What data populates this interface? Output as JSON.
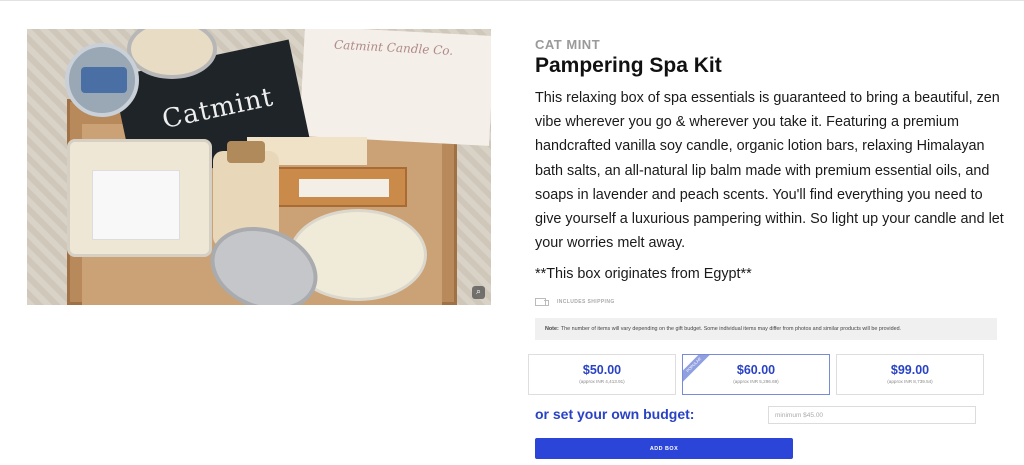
{
  "product": {
    "brand": "CAT MINT",
    "title": "Pampering Spa Kit",
    "description": "This relaxing box of spa essentials is guaranteed to bring a beautiful, zen vibe wherever you go & wherever you take it. Featuring a premium handcrafted vanilla soy candle, organic lotion bars, relaxing Himalayan bath salts, an all-natural lip balm made with premium essential oils, and soaps in lavender and peach scents. You'll find everything you need to give yourself a luxurious pampering within. So light up your candle and let your worries melt away.",
    "origin": "**This box originates from Egypt**",
    "shipping_label": "INCLUDES SHIPPING",
    "note_label": "Note:",
    "note_text": "The number of items will vary depending on the gift budget. Some individual items may differ from photos and similar products will be provided.",
    "photo_brand_text": "Catmint",
    "photo_card_text": "Catmint Candle Co.",
    "zoom_icon": "magnify-icon"
  },
  "budget": {
    "options": [
      {
        "price": "$50.00",
        "approx": "(approx INR 4,413.91)",
        "selected": false
      },
      {
        "price": "$60.00",
        "approx": "(approx INR 5,296.69)",
        "selected": true,
        "ribbon": "POPULAR"
      },
      {
        "price": "$99.00",
        "approx": "(approx INR 8,739.54)",
        "selected": false
      }
    ],
    "own_label": "or set your own budget:",
    "own_placeholder": "minimum $45.00",
    "add_label": "ADD BOX"
  },
  "colors": {
    "accent": "#2a43c4",
    "button": "#2a45d8",
    "brand_gray": "#9a9a9a"
  }
}
